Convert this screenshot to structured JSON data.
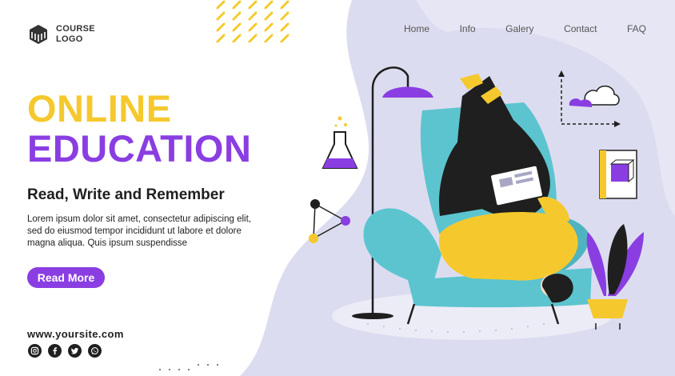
{
  "logo": {
    "line1": "COURSE",
    "line2": "LOGO"
  },
  "nav": [
    "Home",
    "Info",
    "Galery",
    "Contact",
    "FAQ"
  ],
  "hero": {
    "headline_line1": "ONLINE",
    "headline_line2": "EDUCATION",
    "subheading": "Read, Write and Remember",
    "body": "Lorem ipsum dolor sit amet, consectetur adipiscing elit, sed do eiusmod tempor incididunt ut labore et dolore magna aliqua. Quis ipsum suspendisse",
    "cta_label": "Read More"
  },
  "footer": {
    "website": "www.yoursite.com"
  },
  "socials": [
    "instagram-icon",
    "facebook-icon",
    "twitter-icon",
    "whatsapp-icon"
  ],
  "colors": {
    "yellow": "#f5c92d",
    "purple": "#8a3ee2",
    "blob": "#dcdcf0",
    "chair": "#5cc4cf",
    "dark": "#1f1f1f"
  }
}
